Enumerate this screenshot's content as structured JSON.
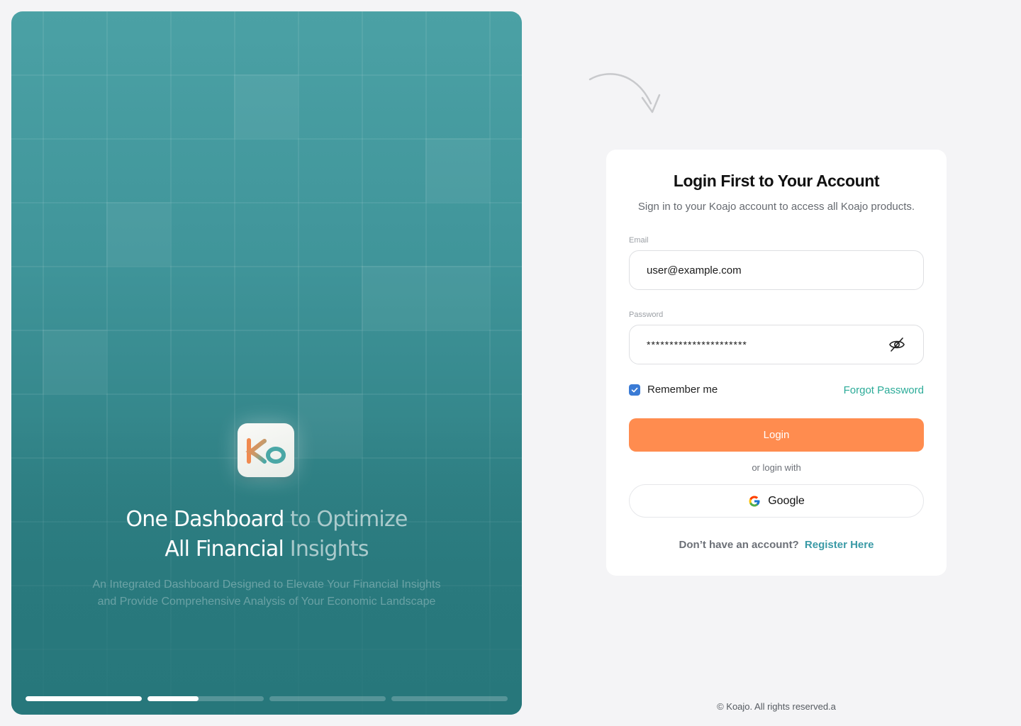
{
  "hero": {
    "title_line1_a": "One Dashboard",
    "title_line1_b": " to Optimize",
    "title_line2_a": "All Financial",
    "title_line2_b": " Insights",
    "subtitle_line1": "An Integrated Dashboard Designed to Elevate Your Financial Insights",
    "subtitle_line2": "and Provide Comprehensive Analysis of Your Economic Landscape",
    "logo_text": "Ko",
    "slides": [
      {
        "progress": 1.0
      },
      {
        "progress": 0.44
      },
      {
        "progress": 0
      },
      {
        "progress": 0
      }
    ]
  },
  "login": {
    "title": "Login First to Your Account",
    "subtitle": "Sign in to your Koajo account to access all Koajo products.",
    "email_label": "Email",
    "email_value": "user@example.com",
    "password_label": "Password",
    "password_masked": "**********************",
    "password_toggle_icon": "eye-off-icon",
    "remember_label": "Remember me",
    "remember_checked": true,
    "forgot_label": "Forgot Password",
    "login_label": "Login",
    "or_text": "or login with",
    "google_label": "Google",
    "no_account_text": "Don’t have an account?",
    "register_label": "Register Here"
  },
  "footer": {
    "copyright": "©  Koajo. All rights reserved.a"
  },
  "colors": {
    "accent_orange": "#ff8c4f",
    "link_teal": "#2bab98",
    "register_teal": "#3a9aa6",
    "hero_teal": "#40959a",
    "checkbox_blue": "#3a7bd5"
  }
}
